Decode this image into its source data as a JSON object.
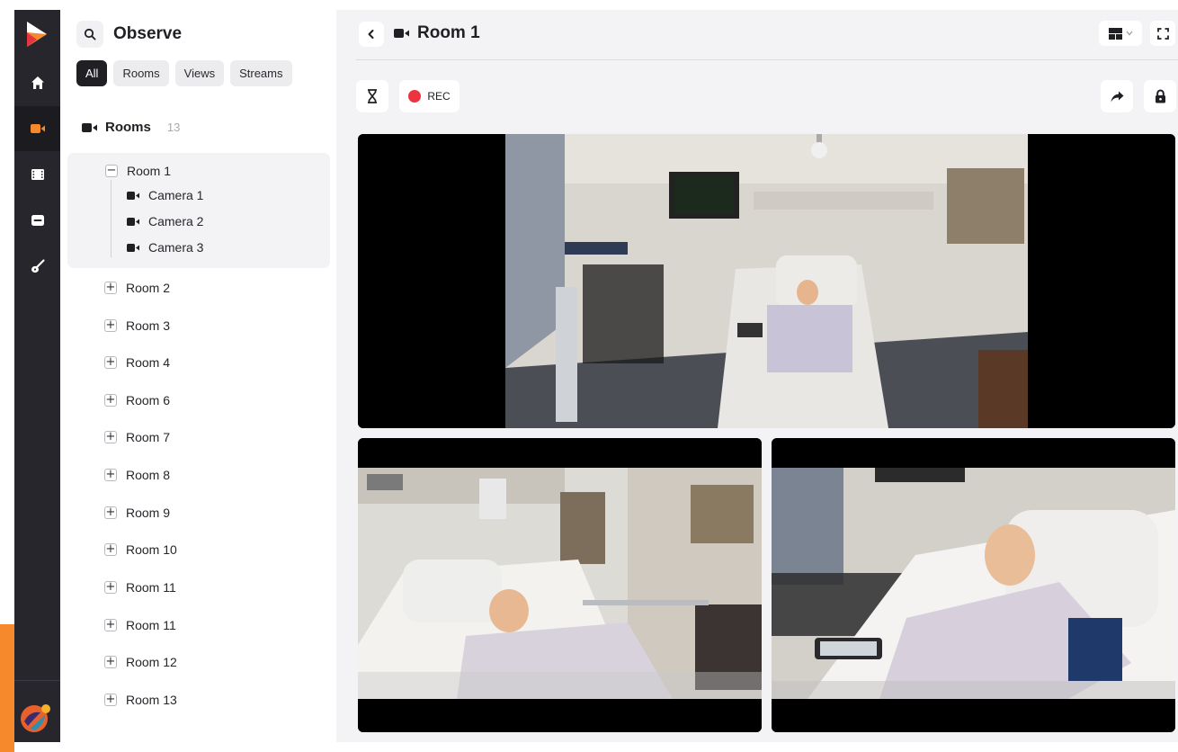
{
  "sidebar": {
    "title": "Observe",
    "filters": [
      "All",
      "Rooms",
      "Views",
      "Streams"
    ],
    "active_filter": "All",
    "rooms_label": "Rooms",
    "rooms_count": "13",
    "open_room": {
      "label": "Room 1",
      "cameras": [
        "Camera 1",
        "Camera 2",
        "Camera 3"
      ]
    },
    "rooms": [
      "Room 2",
      "Room 3",
      "Room 4",
      "Room 6",
      "Room 7",
      "Room 8",
      "Room 9",
      "Room 10",
      "Room 11",
      "Room 11",
      "Room 12",
      "Room 13"
    ]
  },
  "rail": {
    "items": [
      "home-icon",
      "video-camera-icon",
      "film-icon",
      "inbox-icon",
      "guitar-icon"
    ],
    "active": "video-camera-icon"
  },
  "main": {
    "title": "Room 1",
    "rec_label": "REC",
    "controls": [
      "back-icon",
      "hourglass-icon",
      "share-icon",
      "lock-icon",
      "layout-icon",
      "fullscreen-icon"
    ]
  },
  "colors": {
    "brand_orange": "#f6892b",
    "rec_red": "#ee3340",
    "rail_bg": "#26262c",
    "main_bg": "#f3f3f5"
  }
}
